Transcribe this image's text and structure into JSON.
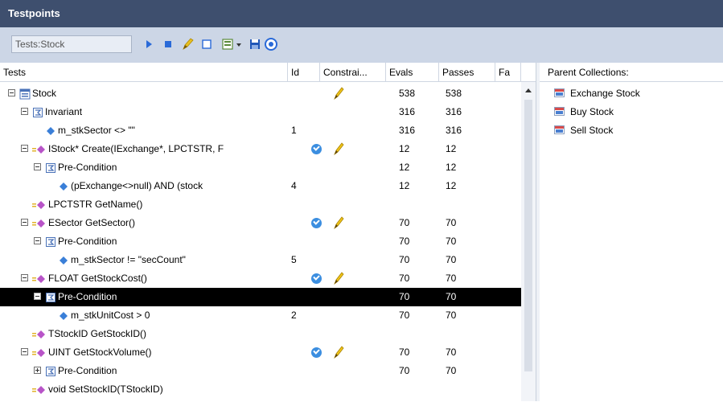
{
  "window": {
    "title": "Testpoints"
  },
  "toolbar": {
    "scope_value": "Tests:Stock"
  },
  "columns": [
    "Tests",
    "Id",
    "Constrai...",
    "Evals",
    "Passes",
    "Fa"
  ],
  "rows": [
    {
      "label": "Stock",
      "id": "",
      "evals": "538",
      "passes": "538",
      "indent": 0,
      "exp": "minus",
      "icon": "class-icon",
      "check": false,
      "pen": true,
      "selected": false
    },
    {
      "label": "Invariant",
      "id": "",
      "evals": "316",
      "passes": "316",
      "indent": 1,
      "exp": "minus",
      "icon": "condition-icon",
      "check": false,
      "pen": false,
      "selected": false
    },
    {
      "label": "m_stkSector <> \"\"",
      "id": "1",
      "evals": "316",
      "passes": "316",
      "indent": 2,
      "exp": "",
      "icon": "testpoint-icon",
      "check": false,
      "pen": false,
      "selected": false
    },
    {
      "label": "IStock* Create(IExchange*, LPCTSTR, F",
      "id": "",
      "evals": "12",
      "passes": "12",
      "indent": 1,
      "exp": "minus",
      "icon": "operation-icon",
      "check": true,
      "pen": true,
      "selected": false
    },
    {
      "label": "Pre-Condition",
      "id": "",
      "evals": "12",
      "passes": "12",
      "indent": 2,
      "exp": "minus",
      "icon": "condition-icon",
      "check": false,
      "pen": false,
      "selected": false
    },
    {
      "label": "(pExchange<>null) AND (stock",
      "id": "4",
      "evals": "12",
      "passes": "12",
      "indent": 3,
      "exp": "",
      "icon": "testpoint-icon",
      "check": false,
      "pen": false,
      "selected": false
    },
    {
      "label": "LPCTSTR GetName()",
      "id": "",
      "evals": "",
      "passes": "",
      "indent": 1,
      "exp": "",
      "icon": "operation-icon",
      "check": false,
      "pen": false,
      "selected": false
    },
    {
      "label": "ESector GetSector()",
      "id": "",
      "evals": "70",
      "passes": "70",
      "indent": 1,
      "exp": "minus",
      "icon": "operation-icon",
      "check": true,
      "pen": true,
      "selected": false
    },
    {
      "label": "Pre-Condition",
      "id": "",
      "evals": "70",
      "passes": "70",
      "indent": 2,
      "exp": "minus",
      "icon": "condition-icon",
      "check": false,
      "pen": false,
      "selected": false
    },
    {
      "label": "m_stkSector != \"secCount\"",
      "id": "5",
      "evals": "70",
      "passes": "70",
      "indent": 3,
      "exp": "",
      "icon": "testpoint-icon",
      "check": false,
      "pen": false,
      "selected": false
    },
    {
      "label": "FLOAT GetStockCost()",
      "id": "",
      "evals": "70",
      "passes": "70",
      "indent": 1,
      "exp": "minus",
      "icon": "operation-icon",
      "check": true,
      "pen": true,
      "selected": false
    },
    {
      "label": "Pre-Condition",
      "id": "",
      "evals": "70",
      "passes": "70",
      "indent": 2,
      "exp": "minus",
      "icon": "condition-icon",
      "check": false,
      "pen": false,
      "selected": true
    },
    {
      "label": "m_stkUnitCost > 0",
      "id": "2",
      "evals": "70",
      "passes": "70",
      "indent": 3,
      "exp": "",
      "icon": "testpoint-icon",
      "check": false,
      "pen": false,
      "selected": false
    },
    {
      "label": "TStockID GetStockID()",
      "id": "",
      "evals": "",
      "passes": "",
      "indent": 1,
      "exp": "",
      "icon": "operation-icon",
      "check": false,
      "pen": false,
      "selected": false
    },
    {
      "label": "UINT GetStockVolume()",
      "id": "",
      "evals": "70",
      "passes": "70",
      "indent": 1,
      "exp": "minus",
      "icon": "operation-icon",
      "check": true,
      "pen": true,
      "selected": false
    },
    {
      "label": "Pre-Condition",
      "id": "",
      "evals": "70",
      "passes": "70",
      "indent": 2,
      "exp": "plus",
      "icon": "condition-icon",
      "check": false,
      "pen": false,
      "selected": false
    },
    {
      "label": "void SetStockID(TStockID)",
      "id": "",
      "evals": "",
      "passes": "",
      "indent": 1,
      "exp": "",
      "icon": "operation-icon",
      "check": false,
      "pen": false,
      "selected": false
    }
  ],
  "parent_panel": {
    "title": "Parent Collections:",
    "items": [
      "Exchange Stock",
      "Buy Stock",
      "Sell Stock"
    ]
  }
}
